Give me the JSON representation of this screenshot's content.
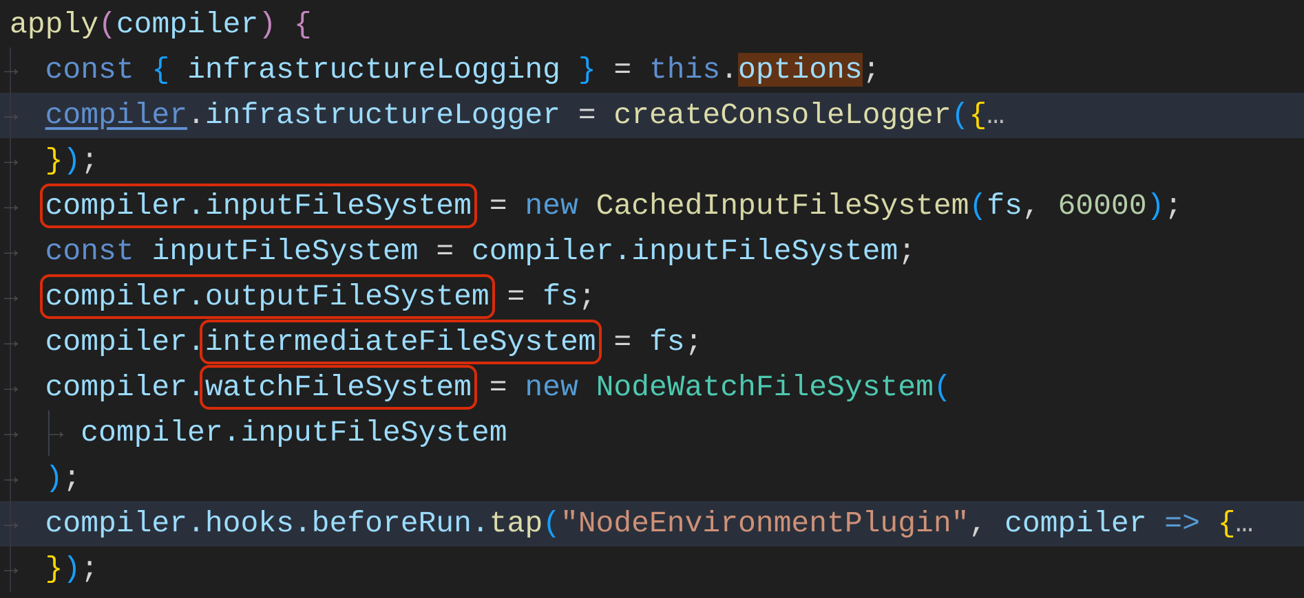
{
  "tab_marker": "→",
  "colors": {
    "highlight_line": "#2a303b",
    "annotation_box": "#d92b0a",
    "background": "#1f1f1f"
  },
  "lines": [
    {
      "indent": 0,
      "tokens": [
        {
          "t": "apply",
          "c": "fn"
        },
        {
          "t": "(",
          "c": "b2"
        },
        {
          "t": "compiler",
          "c": "var"
        },
        {
          "t": ")",
          "c": "b2"
        },
        {
          "t": " ",
          "c": "plain"
        },
        {
          "t": "{",
          "c": "b2"
        }
      ]
    },
    {
      "indent": 1,
      "tokens": [
        {
          "t": "const",
          "c": "const"
        },
        {
          "t": " ",
          "c": "plain"
        },
        {
          "t": "{",
          "c": "b3"
        },
        {
          "t": " infrastructureLogging ",
          "c": "var"
        },
        {
          "t": "}",
          "c": "b3"
        },
        {
          "t": " = ",
          "c": "plain"
        },
        {
          "t": "this",
          "c": "const"
        },
        {
          "t": ".",
          "c": "plain"
        },
        {
          "t": "options",
          "c": "var findmatch"
        },
        {
          "t": ";",
          "c": "plain"
        }
      ]
    },
    {
      "indent": 1,
      "hl": true,
      "tokens": [
        {
          "t": "compiler",
          "c": "link"
        },
        {
          "t": ".",
          "c": "plain"
        },
        {
          "t": "infrastructureLogger",
          "c": "var"
        },
        {
          "t": " = ",
          "c": "plain"
        },
        {
          "t": "createConsoleLogger",
          "c": "fn"
        },
        {
          "t": "(",
          "c": "b3"
        },
        {
          "t": "{",
          "c": "b1"
        },
        {
          "t": "…",
          "c": "ellip"
        }
      ]
    },
    {
      "indent": 1,
      "tokens": [
        {
          "t": "}",
          "c": "b1"
        },
        {
          "t": ")",
          "c": "b3"
        },
        {
          "t": ";",
          "c": "plain"
        }
      ]
    },
    {
      "indent": 1,
      "tokens": [
        {
          "t": "compiler.inputFileSystem",
          "c": "var",
          "boxed": true
        },
        {
          "t": " = ",
          "c": "plain"
        },
        {
          "t": "new",
          "c": "kw"
        },
        {
          "t": " ",
          "c": "plain"
        },
        {
          "t": "CachedInputFileSystem",
          "c": "cls"
        },
        {
          "t": "(",
          "c": "b3"
        },
        {
          "t": "fs",
          "c": "var"
        },
        {
          "t": ", ",
          "c": "plain"
        },
        {
          "t": "60000",
          "c": "num"
        },
        {
          "t": ")",
          "c": "b3"
        },
        {
          "t": ";",
          "c": "plain"
        }
      ]
    },
    {
      "indent": 1,
      "tokens": [
        {
          "t": "const",
          "c": "const"
        },
        {
          "t": " ",
          "c": "plain"
        },
        {
          "t": "inputFileSystem",
          "c": "var"
        },
        {
          "t": " = ",
          "c": "plain"
        },
        {
          "t": "compiler.inputFileSystem",
          "c": "var"
        },
        {
          "t": ";",
          "c": "plain"
        }
      ]
    },
    {
      "indent": 1,
      "tokens": [
        {
          "t": "compiler.outputFileSystem",
          "c": "var",
          "boxed": true
        },
        {
          "t": " = ",
          "c": "plain"
        },
        {
          "t": "fs",
          "c": "var"
        },
        {
          "t": ";",
          "c": "plain"
        }
      ]
    },
    {
      "indent": 1,
      "tokens": [
        {
          "t": "compiler.",
          "c": "var"
        },
        {
          "t": "intermediateFileSystem",
          "c": "var",
          "boxed": true
        },
        {
          "t": " = ",
          "c": "plain"
        },
        {
          "t": "fs",
          "c": "var"
        },
        {
          "t": ";",
          "c": "plain"
        }
      ]
    },
    {
      "indent": 1,
      "tokens": [
        {
          "t": "compiler.",
          "c": "var"
        },
        {
          "t": "watchFileSystem",
          "c": "var",
          "boxed": true
        },
        {
          "t": " = ",
          "c": "plain"
        },
        {
          "t": "new",
          "c": "kw"
        },
        {
          "t": " ",
          "c": "plain"
        },
        {
          "t": "NodeWatchFileSystem",
          "c": "cls2"
        },
        {
          "t": "(",
          "c": "b3"
        }
      ]
    },
    {
      "indent": 2,
      "tokens": [
        {
          "t": "compiler.inputFileSystem",
          "c": "var"
        }
      ]
    },
    {
      "indent": 1,
      "tokens": [
        {
          "t": ")",
          "c": "b3"
        },
        {
          "t": ";",
          "c": "plain"
        }
      ]
    },
    {
      "indent": 1,
      "hl": true,
      "tokens": [
        {
          "t": "compiler.hooks.beforeRun.",
          "c": "var"
        },
        {
          "t": "tap",
          "c": "fn"
        },
        {
          "t": "(",
          "c": "b3"
        },
        {
          "t": "\"NodeEnvironmentPlugin\"",
          "c": "str"
        },
        {
          "t": ", ",
          "c": "plain"
        },
        {
          "t": "compiler",
          "c": "var"
        },
        {
          "t": " => ",
          "c": "kw"
        },
        {
          "t": "{",
          "c": "b1"
        },
        {
          "t": "…",
          "c": "ellip"
        }
      ]
    },
    {
      "indent": 1,
      "tokens": [
        {
          "t": "}",
          "c": "b1"
        },
        {
          "t": ")",
          "c": "b3"
        },
        {
          "t": ";",
          "c": "plain"
        }
      ]
    }
  ]
}
